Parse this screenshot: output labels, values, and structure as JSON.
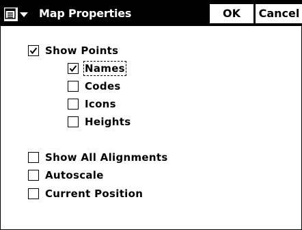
{
  "dialog": {
    "title": "Map Properties",
    "ok_label": "OK",
    "cancel_label": "Cancel",
    "menu_icon": "list-menu-icon"
  },
  "options": {
    "show_points": {
      "label": "Show Points",
      "checked": true
    },
    "names": {
      "label": "Names",
      "checked": true,
      "focused": true
    },
    "codes": {
      "label": "Codes",
      "checked": false
    },
    "icons": {
      "label": "Icons",
      "checked": false
    },
    "heights": {
      "label": "Heights",
      "checked": false
    },
    "show_all_alignments": {
      "label": "Show All Alignments",
      "checked": false
    },
    "autoscale": {
      "label": "Autoscale",
      "checked": false
    },
    "current_position": {
      "label": "Current Position",
      "checked": false
    }
  },
  "colors": {
    "titlebar": "#000000",
    "background": "#ffffff"
  }
}
